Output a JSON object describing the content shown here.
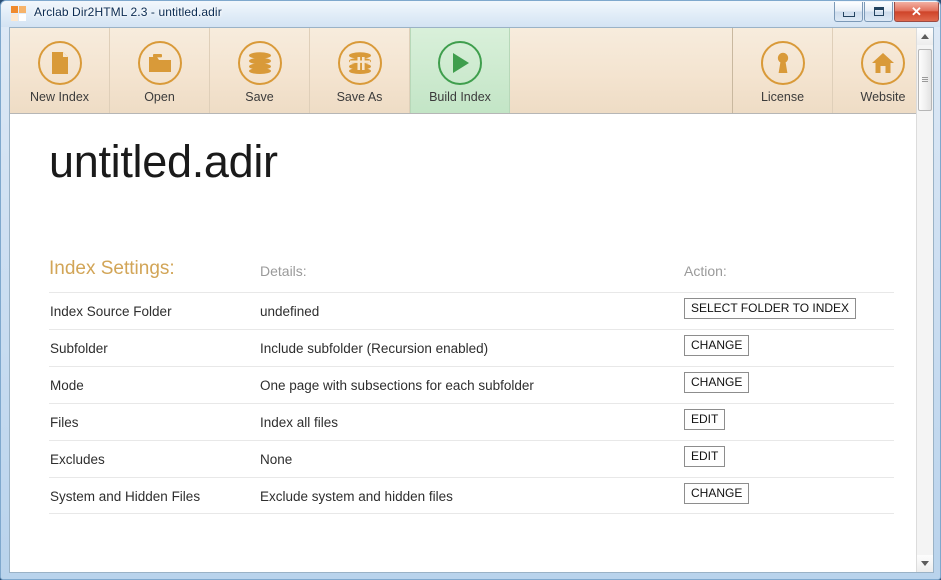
{
  "window": {
    "title": "Arclab Dir2HTML 2.3 - untitled.adir",
    "app_icon": "arclab-logo-icon",
    "controls": {
      "minimize_label": "Minimize",
      "maximize_label": "Maximize",
      "close_label": "✕"
    }
  },
  "toolbar": {
    "items": [
      {
        "label": "New Index",
        "icon": "new-document-icon",
        "active": false,
        "color": "#d99a39"
      },
      {
        "label": "Open",
        "icon": "open-folder-icon",
        "active": false,
        "color": "#d99a39"
      },
      {
        "label": "Save",
        "icon": "save-disk-stack-icon",
        "active": false,
        "color": "#d99a39"
      },
      {
        "label": "Save As",
        "icon": "save-as-disk-stack-icon",
        "active": false,
        "color": "#d99a39"
      },
      {
        "label": "Build Index",
        "icon": "play-build-icon",
        "active": true,
        "color": "#3f9e4d"
      },
      {
        "label": "License",
        "icon": "keyhole-license-icon",
        "active": false,
        "color": "#d99a39"
      },
      {
        "label": "Website",
        "icon": "home-website-icon",
        "active": false,
        "color": "#d99a39"
      }
    ]
  },
  "page": {
    "document_title": "untitled.adir",
    "columns": {
      "settings": "Index Settings:",
      "details": "Details:",
      "action": "Action:"
    },
    "rows": [
      {
        "name": "Index Source Folder",
        "detail": "undefined",
        "action": "SELECT FOLDER TO INDEX"
      },
      {
        "name": "Subfolder",
        "detail": "Include subfolder (Recursion enabled)",
        "action": "CHANGE"
      },
      {
        "name": "Mode",
        "detail": "One page with subsections for each subfolder",
        "action": "CHANGE"
      },
      {
        "name": "Files",
        "detail": "Index all files",
        "action": "EDIT"
      },
      {
        "name": "Excludes",
        "detail": "None",
        "action": "EDIT"
      },
      {
        "name": "System and Hidden Files",
        "detail": "Exclude system and hidden files",
        "action": "CHANGE"
      }
    ]
  },
  "scrollbar": {
    "up_arrow": "scroll-up-arrow-icon",
    "down_arrow": "scroll-down-arrow-icon",
    "thumb": "scroll-thumb"
  },
  "colors": {
    "toolbar_bg": "#f4e4d0",
    "accent_orange": "#d99a39",
    "accent_green": "#3f9e4d",
    "heading_tan": "#d2a557",
    "muted_gray": "#9a9a9a"
  }
}
